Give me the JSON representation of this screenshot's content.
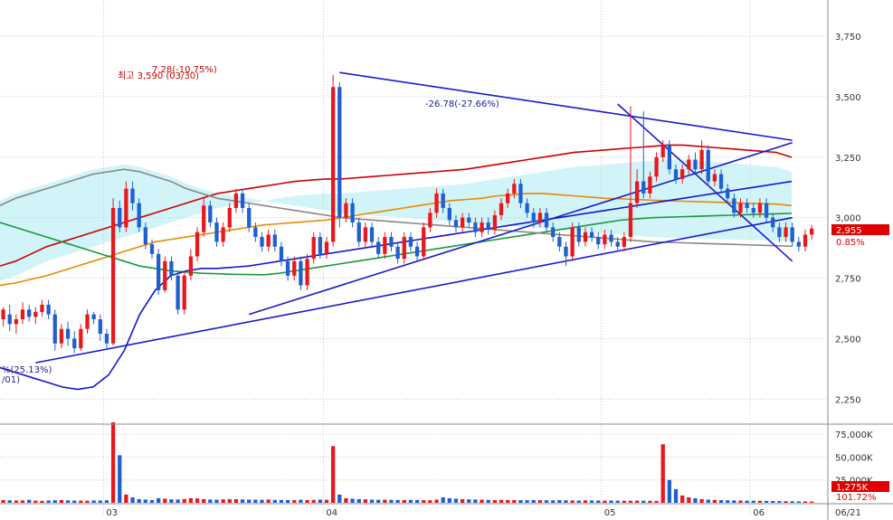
{
  "chart_data": {
    "type": "candlestick",
    "price_axis": {
      "ticks": [
        "3,750",
        "3,500",
        "3,250",
        "3,000",
        "2,750",
        "2,500",
        "2,250"
      ],
      "tick_values": [
        3750,
        3500,
        3250,
        3000,
        2750,
        2500,
        2250
      ],
      "ylim": [
        2150,
        3900
      ]
    },
    "volume_axis": {
      "ticks": [
        "75,000K",
        "50,000K",
        "25,000K"
      ],
      "tick_values": [
        75000,
        50000,
        25000
      ],
      "ylim": [
        0,
        85000
      ]
    },
    "x_axis": {
      "month_labels": [
        "03",
        "04",
        "05",
        "06"
      ],
      "last_label": "06/21"
    },
    "current_price": {
      "label": "2,955",
      "value": 2955,
      "change": "0.85%"
    },
    "current_volume": {
      "label": "1,275K",
      "value": 1275,
      "change": "101.72%"
    },
    "annotations": {
      "high": "최고 3,590 (03/30)",
      "high_change": "7.28(-10.75%)",
      "low_change": "%(25.13%)",
      "low_date": "/01)",
      "mid_change": "-26.78(-27.66%)"
    },
    "candles": [
      [
        2580,
        2620,
        2550,
        2630
      ],
      [
        2600,
        2560,
        2530,
        2640
      ],
      [
        2560,
        2580,
        2520,
        2600
      ],
      [
        2580,
        2620,
        2560,
        2650
      ],
      [
        2620,
        2590,
        2570,
        2640
      ],
      [
        2590,
        2610,
        2560,
        2630
      ],
      [
        2610,
        2640,
        2590,
        2660
      ],
      [
        2640,
        2600,
        2580,
        2660
      ],
      [
        2600,
        2480,
        2450,
        2620
      ],
      [
        2480,
        2540,
        2460,
        2560
      ],
      [
        2540,
        2500,
        2470,
        2570
      ],
      [
        2500,
        2460,
        2440,
        2530
      ],
      [
        2460,
        2540,
        2450,
        2560
      ],
      [
        2540,
        2600,
        2520,
        2620
      ],
      [
        2600,
        2580,
        2560,
        2610
      ],
      [
        2580,
        2520,
        2490,
        2600
      ],
      [
        2520,
        2480,
        2460,
        2540
      ],
      [
        2480,
        3040,
        2470,
        3080
      ],
      [
        3040,
        2960,
        2940,
        3070
      ],
      [
        2960,
        3120,
        2940,
        3150
      ],
      [
        3120,
        3060,
        3030,
        3150
      ],
      [
        3060,
        2960,
        2940,
        3080
      ],
      [
        2960,
        2890,
        2870,
        2980
      ],
      [
        2890,
        2850,
        2830,
        2910
      ],
      [
        2850,
        2700,
        2680,
        2870
      ],
      [
        2700,
        2820,
        2690,
        2840
      ],
      [
        2820,
        2760,
        2740,
        2840
      ],
      [
        2760,
        2620,
        2600,
        2780
      ],
      [
        2620,
        2760,
        2600,
        2780
      ],
      [
        2760,
        2840,
        2740,
        2870
      ],
      [
        2840,
        2940,
        2820,
        2960
      ],
      [
        2940,
        3050,
        2920,
        3080
      ],
      [
        3050,
        2980,
        2960,
        3070
      ],
      [
        2980,
        2900,
        2880,
        3000
      ],
      [
        2900,
        2960,
        2880,
        2980
      ],
      [
        2960,
        3040,
        2940,
        3060
      ],
      [
        3040,
        3100,
        3020,
        3120
      ],
      [
        3100,
        3040,
        3020,
        3120
      ],
      [
        3040,
        2960,
        2940,
        3060
      ],
      [
        2960,
        2920,
        2900,
        2980
      ],
      [
        2920,
        2880,
        2860,
        2940
      ],
      [
        2880,
        2930,
        2860,
        2950
      ],
      [
        2930,
        2880,
        2860,
        2950
      ],
      [
        2880,
        2820,
        2800,
        2900
      ],
      [
        2820,
        2760,
        2740,
        2840
      ],
      [
        2760,
        2820,
        2740,
        2840
      ],
      [
        2820,
        2720,
        2700,
        2840
      ],
      [
        2720,
        2830,
        2700,
        2850
      ],
      [
        2830,
        2920,
        2810,
        2940
      ],
      [
        2920,
        2850,
        2830,
        2940
      ],
      [
        2850,
        2900,
        2830,
        2920
      ],
      [
        2900,
        3540,
        2880,
        3590
      ],
      [
        3540,
        3000,
        2960,
        3560
      ],
      [
        3000,
        3060,
        2980,
        3080
      ],
      [
        3060,
        2980,
        2960,
        3080
      ],
      [
        2980,
        2900,
        2880,
        3000
      ],
      [
        2900,
        2960,
        2880,
        2980
      ],
      [
        2960,
        2900,
        2880,
        2980
      ],
      [
        2900,
        2850,
        2830,
        2920
      ],
      [
        2850,
        2920,
        2830,
        2940
      ],
      [
        2920,
        2880,
        2860,
        2940
      ],
      [
        2880,
        2830,
        2810,
        2900
      ],
      [
        2830,
        2920,
        2810,
        2940
      ],
      [
        2920,
        2880,
        2860,
        2940
      ],
      [
        2880,
        2840,
        2820,
        2900
      ],
      [
        2840,
        2960,
        2830,
        2980
      ],
      [
        2960,
        3020,
        2940,
        3040
      ],
      [
        3020,
        3100,
        3000,
        3120
      ],
      [
        3100,
        3040,
        3020,
        3120
      ],
      [
        3040,
        2990,
        2970,
        3060
      ],
      [
        2990,
        2960,
        2940,
        3010
      ],
      [
        2960,
        3000,
        2940,
        3020
      ],
      [
        3000,
        2980,
        2960,
        3020
      ],
      [
        2980,
        2940,
        2920,
        3000
      ],
      [
        2940,
        2980,
        2920,
        3000
      ],
      [
        2980,
        2950,
        2930,
        3000
      ],
      [
        2950,
        3010,
        2930,
        3030
      ],
      [
        3010,
        3060,
        2990,
        3080
      ],
      [
        3060,
        3100,
        3040,
        3120
      ],
      [
        3100,
        3140,
        3080,
        3160
      ],
      [
        3140,
        3060,
        3040,
        3160
      ],
      [
        3060,
        3020,
        3000,
        3080
      ],
      [
        3020,
        2980,
        2960,
        3040
      ],
      [
        2980,
        3020,
        2960,
        3040
      ],
      [
        3020,
        2960,
        2940,
        3040
      ],
      [
        2960,
        2920,
        2900,
        2980
      ],
      [
        2920,
        2880,
        2860,
        2940
      ],
      [
        2880,
        2840,
        2800,
        2900
      ],
      [
        2840,
        2960,
        2820,
        2980
      ],
      [
        2960,
        2900,
        2880,
        2980
      ],
      [
        2900,
        2940,
        2880,
        2960
      ],
      [
        2940,
        2920,
        2900,
        2960
      ],
      [
        2920,
        2890,
        2870,
        2940
      ],
      [
        2890,
        2930,
        2870,
        2950
      ],
      [
        2930,
        2900,
        2880,
        2950
      ],
      [
        2900,
        2880,
        2860,
        2920
      ],
      [
        2880,
        2920,
        2860,
        2940
      ],
      [
        2920,
        3060,
        2900,
        3460
      ],
      [
        3060,
        3150,
        3040,
        3200
      ],
      [
        3150,
        3100,
        3080,
        3440
      ],
      [
        3100,
        3170,
        3080,
        3190
      ],
      [
        3170,
        3250,
        3150,
        3270
      ],
      [
        3250,
        3300,
        3230,
        3320
      ],
      [
        3300,
        3200,
        3180,
        3320
      ],
      [
        3200,
        3160,
        3140,
        3220
      ],
      [
        3160,
        3200,
        3140,
        3220
      ],
      [
        3200,
        3240,
        3180,
        3260
      ],
      [
        3240,
        3200,
        3180,
        3270
      ],
      [
        3200,
        3280,
        3180,
        3320
      ],
      [
        3280,
        3150,
        3130,
        3300
      ],
      [
        3150,
        3180,
        3130,
        3200
      ],
      [
        3180,
        3120,
        3100,
        3200
      ],
      [
        3120,
        3080,
        3060,
        3140
      ],
      [
        3080,
        3020,
        3000,
        3100
      ],
      [
        3020,
        3060,
        3000,
        3080
      ],
      [
        3060,
        3040,
        3020,
        3080
      ],
      [
        3040,
        3020,
        3000,
        3060
      ],
      [
        3020,
        3060,
        3000,
        3080
      ],
      [
        3060,
        3000,
        2980,
        3080
      ],
      [
        3000,
        2960,
        2940,
        3020
      ],
      [
        2960,
        2920,
        2900,
        2980
      ],
      [
        2920,
        2960,
        2900,
        2980
      ],
      [
        2960,
        2900,
        2880,
        2980
      ],
      [
        2900,
        2880,
        2860,
        2920
      ],
      [
        2880,
        2930,
        2860,
        2950
      ],
      [
        2930,
        2955,
        2910,
        2970
      ]
    ],
    "volume": [
      3000,
      2800,
      2500,
      2600,
      3200,
      2400,
      2200,
      2600,
      2800,
      3000,
      2700,
      2500,
      2400,
      2300,
      2600,
      2500,
      2800,
      88000,
      52000,
      9000,
      6000,
      4000,
      3500,
      3000,
      5000,
      4500,
      3800,
      3600,
      4200,
      5000,
      4800,
      4000,
      3600,
      3400,
      3800,
      4000,
      3900,
      3700,
      3500,
      3400,
      3300,
      3600,
      3200,
      3100,
      3000,
      2900,
      3400,
      3000,
      3200,
      3500,
      3300,
      62000,
      9000,
      5000,
      4500,
      4000,
      3800,
      3500,
      3300,
      3400,
      3200,
      3100,
      3000,
      3200,
      3100,
      2900,
      2800,
      3500,
      6000,
      5000,
      4500,
      4000,
      3800,
      3600,
      3400,
      3200,
      3000,
      3200,
      3100,
      3000,
      2900,
      2800,
      3000,
      2900,
      2800,
      2700,
      3000,
      2800,
      2600,
      2500,
      2700,
      2600,
      2500,
      2400,
      2500,
      2400,
      2300,
      2200,
      2400,
      2300,
      2200,
      2100,
      64000,
      25000,
      15000,
      8000,
      6000,
      5000,
      4000,
      3500,
      3200,
      3000,
      2800,
      2600,
      2500,
      2400,
      2300,
      2200,
      2100,
      2000,
      1900,
      1800,
      1700,
      1600,
      1500,
      1400,
      1300,
      1275
    ],
    "overlay_lines": [
      {
        "color": "#cc0000",
        "values": [
          2800,
          2820,
          2850,
          2880,
          2900,
          2920,
          2940,
          2960,
          2980,
          3000,
          3020,
          3040,
          3060,
          3080,
          3100,
          3110,
          3120,
          3130,
          3140,
          3150,
          3155,
          3160,
          3160,
          3165,
          3170,
          3175,
          3180,
          3185,
          3190,
          3195,
          3200,
          3210,
          3220,
          3230,
          3240,
          3250,
          3260,
          3270,
          3275,
          3280,
          3285,
          3290,
          3295,
          3300,
          3300,
          3295,
          3290,
          3285,
          3280,
          3275,
          3270,
          3250
        ]
      },
      {
        "color": "#e88a00",
        "values": [
          2720,
          2730,
          2745,
          2760,
          2780,
          2800,
          2820,
          2840,
          2860,
          2880,
          2900,
          2910,
          2920,
          2930,
          2940,
          2950,
          2960,
          2970,
          2975,
          2980,
          2985,
          2990,
          3000,
          3010,
          3020,
          3030,
          3040,
          3050,
          3060,
          3070,
          3075,
          3080,
          3090,
          3095,
          3100,
          3100,
          3095,
          3090,
          3085,
          3080,
          3078,
          3075,
          3072,
          3070,
          3068,
          3066,
          3064,
          3062,
          3060,
          3058,
          3056,
          3050
        ]
      },
      {
        "color": "#1a9a3a",
        "values": [
          2980,
          2960,
          2940,
          2920,
          2900,
          2880,
          2860,
          2840,
          2820,
          2800,
          2790,
          2780,
          2775,
          2770,
          2768,
          2766,
          2765,
          2764,
          2770,
          2780,
          2790,
          2800,
          2810,
          2820,
          2830,
          2840,
          2850,
          2860,
          2870,
          2880,
          2890,
          2900,
          2910,
          2920,
          2930,
          2940,
          2950,
          2960,
          2970,
          2980,
          2990,
          2995,
          3000,
          3002,
          3004,
          3006,
          3008,
          3010,
          3012,
          3014,
          3016,
          3018
        ]
      },
      {
        "color": "#888888",
        "values": [
          3050,
          3080,
          3100,
          3120,
          3140,
          3160,
          3180,
          3190,
          3200,
          3190,
          3170,
          3150,
          3120,
          3100,
          3080,
          3070,
          3060,
          3050,
          3040,
          3030,
          3020,
          3010,
          3000,
          2995,
          2990,
          2985,
          2980,
          2975,
          2970,
          2965,
          2960,
          2955,
          2950,
          2945,
          2940,
          2935,
          2930,
          2925,
          2920,
          2915,
          2910,
          2905,
          2900,
          2898,
          2896,
          2894,
          2892,
          2890,
          2888,
          2886,
          2884,
          2882
        ]
      },
      {
        "color": "#1515cc",
        "values": [
          2380,
          2360,
          2340,
          2320,
          2300,
          2290,
          2300,
          2350,
          2450,
          2600,
          2700,
          2760,
          2780,
          2790,
          2790,
          2795,
          2800,
          2810,
          2820,
          2830,
          2840,
          2850,
          2860,
          2870,
          2880,
          2890,
          2900,
          2910,
          2920,
          2930,
          2940,
          2950,
          2960,
          2970,
          2980,
          2990,
          3000,
          3010,
          3020,
          3030,
          3040,
          3050,
          3060,
          3070,
          3080,
          3090,
          3100,
          3110,
          3120,
          3130,
          3140,
          3150
        ]
      }
    ],
    "trendlines": [
      {
        "color": "#1a1acc",
        "from": [
          38,
          2600
        ],
        "to": [
          122,
          3310
        ]
      },
      {
        "color": "#1a1acc",
        "from": [
          52,
          3600
        ],
        "to": [
          122,
          3320
        ]
      },
      {
        "color": "#1a1acc",
        "from": [
          5,
          2400
        ],
        "to": [
          122,
          3000
        ]
      },
      {
        "color": "#1a1acc",
        "from": [
          95,
          3470
        ],
        "to": [
          122,
          2820
        ]
      }
    ]
  }
}
